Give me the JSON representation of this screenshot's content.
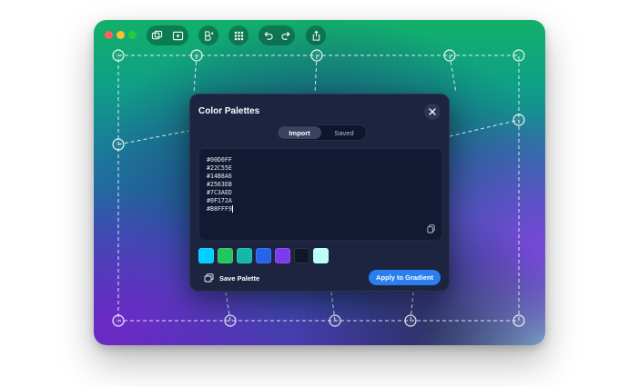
{
  "window": {
    "traffic_lights": {
      "close_color": "#ff5f57",
      "minimize_color": "#febc2e",
      "zoom_color": "#28c840"
    },
    "toolbar": {
      "groups": [
        {
          "icons": [
            "window-stack-icon",
            "window-add-icon"
          ]
        },
        {
          "icons": [
            "palette-icon"
          ]
        },
        {
          "icons": [
            "grid-icon"
          ]
        },
        {
          "icons": [
            "undo-icon",
            "redo-icon"
          ]
        },
        {
          "icons": [
            "share-icon"
          ]
        }
      ]
    }
  },
  "dialog": {
    "title": "Color Palettes",
    "tabs": [
      {
        "label": "Import",
        "active": true
      },
      {
        "label": "Saved",
        "active": false
      }
    ],
    "editor_lines": [
      "#00D0FF",
      "#22C55E",
      "#14B8A6",
      "#2563EB",
      "#7C3AED",
      "#0F172A",
      "#B8FFF9"
    ],
    "swatches": [
      "#00D0FF",
      "#22C55E",
      "#14B8A6",
      "#2563EB",
      "#7C3AED",
      "#0F172A",
      "#B8FFF9"
    ],
    "save_label": "Save Palette",
    "apply_label": "Apply to Gradient"
  }
}
